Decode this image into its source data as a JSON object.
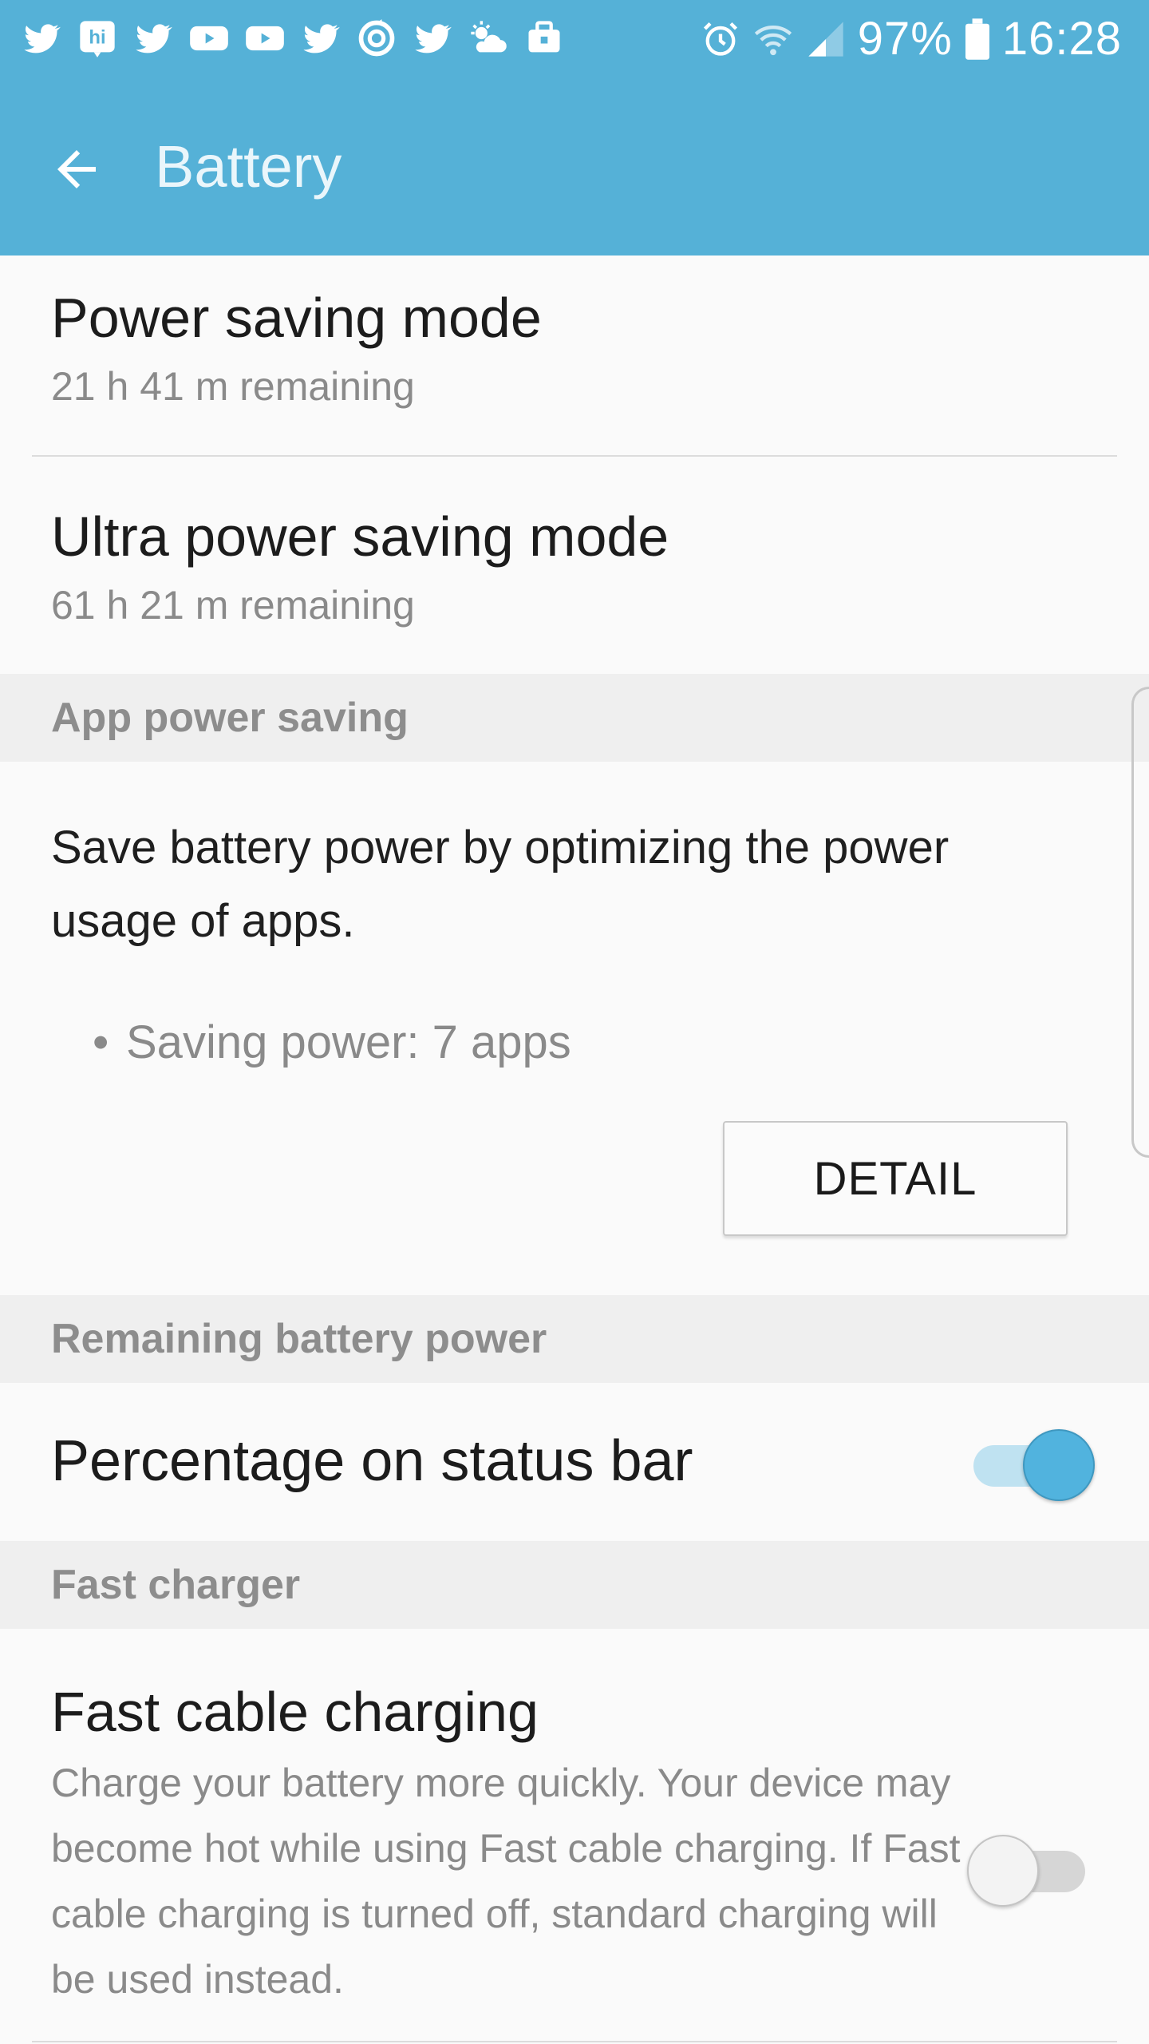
{
  "status_bar": {
    "notification_icons": [
      "twitter-icon",
      "hike-icon",
      "twitter-icon",
      "youtube-icon",
      "youtube-icon",
      "twitter-icon",
      "sync-icon",
      "twitter-icon",
      "weather-icon",
      "briefcase-icon"
    ],
    "battery_percent_text": "97%",
    "time": "16:28"
  },
  "app_bar": {
    "title": "Battery"
  },
  "power_saving": {
    "title": "Power saving mode",
    "subtitle": "21 h 41 m remaining"
  },
  "ultra_power_saving": {
    "title": "Ultra power saving mode",
    "subtitle": "61 h 21 m remaining"
  },
  "app_power_saving": {
    "header": "App power saving",
    "description": "Save battery power by optimizing the power usage of apps.",
    "bullet": "Saving power: 7 apps",
    "detail_button": "DETAIL"
  },
  "remaining_battery": {
    "header": "Remaining battery power",
    "percentage_label": "Percentage on status bar",
    "percentage_enabled": true
  },
  "fast_charger": {
    "header": "Fast charger",
    "title": "Fast cable charging",
    "description": "Charge your battery more quickly. Your device may become hot while using Fast cable charging. If Fast cable charging is turned off, standard charging will be used instead.",
    "enabled": false
  },
  "colors": {
    "accent": "#55b1d7",
    "toggle_on": "#51b3de"
  }
}
